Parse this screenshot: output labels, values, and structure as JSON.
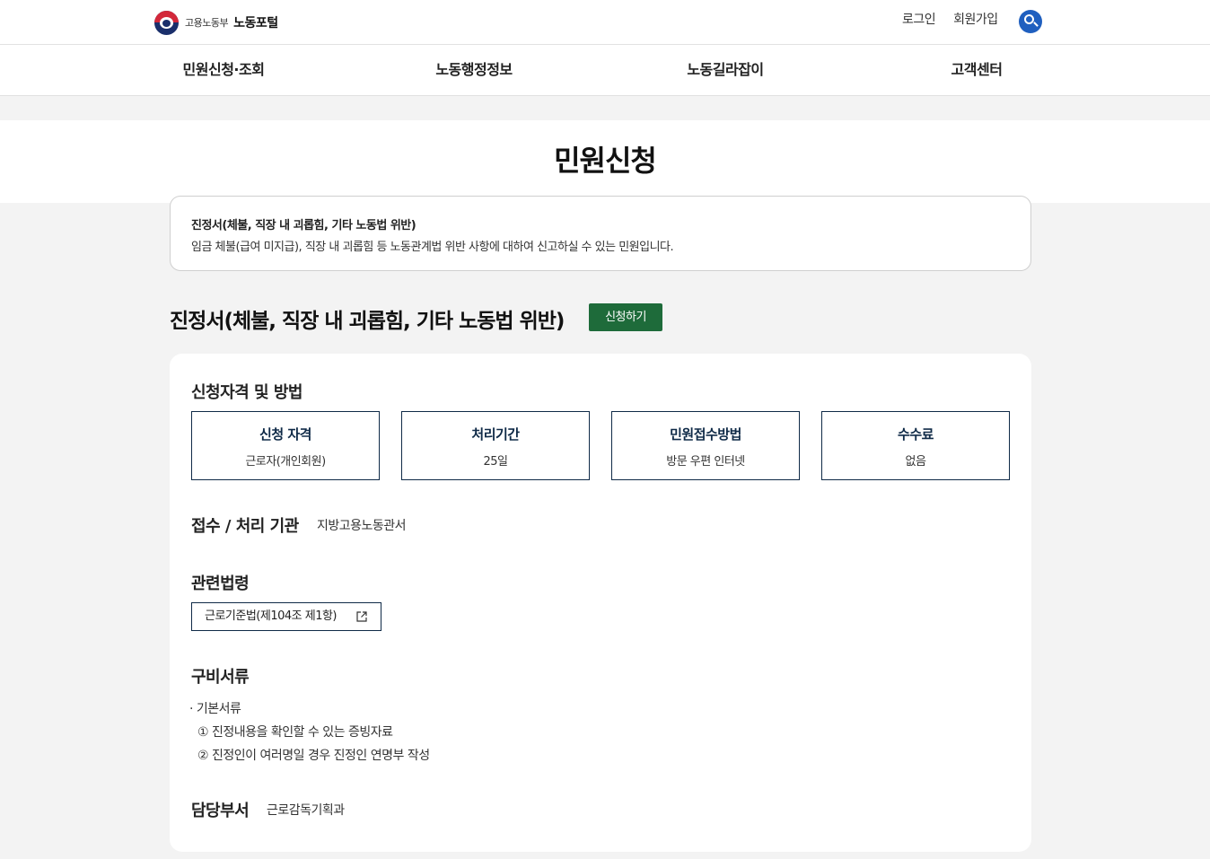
{
  "header": {
    "ministry": "고용노동부",
    "portal": "노동포털",
    "login": "로그인",
    "signup": "회원가입"
  },
  "gnb": [
    {
      "label": "민원신청·조회"
    },
    {
      "label": "노동행정정보"
    },
    {
      "label": "노동길라잡이"
    },
    {
      "label": "고객센터"
    }
  ],
  "page": {
    "title": "민원신청"
  },
  "summary": {
    "title": "진정서(체불, 직장 내 괴롭힘, 기타 노동법 위반)",
    "desc": "임금 체불(급여 미지급), 직장 내 괴롭힘 등 노동관계법 위반 사항에 대하여 신고하실 수 있는 민원입니다."
  },
  "service": {
    "title": "진정서(체불, 직장 내 괴롭힘, 기타 노동법 위반)",
    "apply_label": "신청하기"
  },
  "qualification": {
    "heading": "신청자격 및 방법",
    "boxes": [
      {
        "label": "신청 자격",
        "value": "근로자(개인회원)"
      },
      {
        "label": "처리기간",
        "value": "25일"
      },
      {
        "label": "민원접수방법",
        "value": "방문 우편 인터넷"
      },
      {
        "label": "수수료",
        "value": "없음"
      }
    ]
  },
  "agency": {
    "heading": "접수 / 처리 기관",
    "value": "지방고용노동관서"
  },
  "law": {
    "heading": "관련법령",
    "link_label": "근로기준법(제104조 제1항)"
  },
  "documents": {
    "heading": "구비서류",
    "group": "· 기본서류",
    "items": [
      "① 진정내용을 확인할 수 있는 증빙자료",
      "② 진정인이 여러명일 경우 진정인 연명부 작성"
    ]
  },
  "department": {
    "heading": "담당부서",
    "value": "근로감독기획과"
  },
  "colors": {
    "apply_button": "#1e6b3a",
    "box_border": "#0f2a47",
    "search_button": "#1f5fbf"
  }
}
